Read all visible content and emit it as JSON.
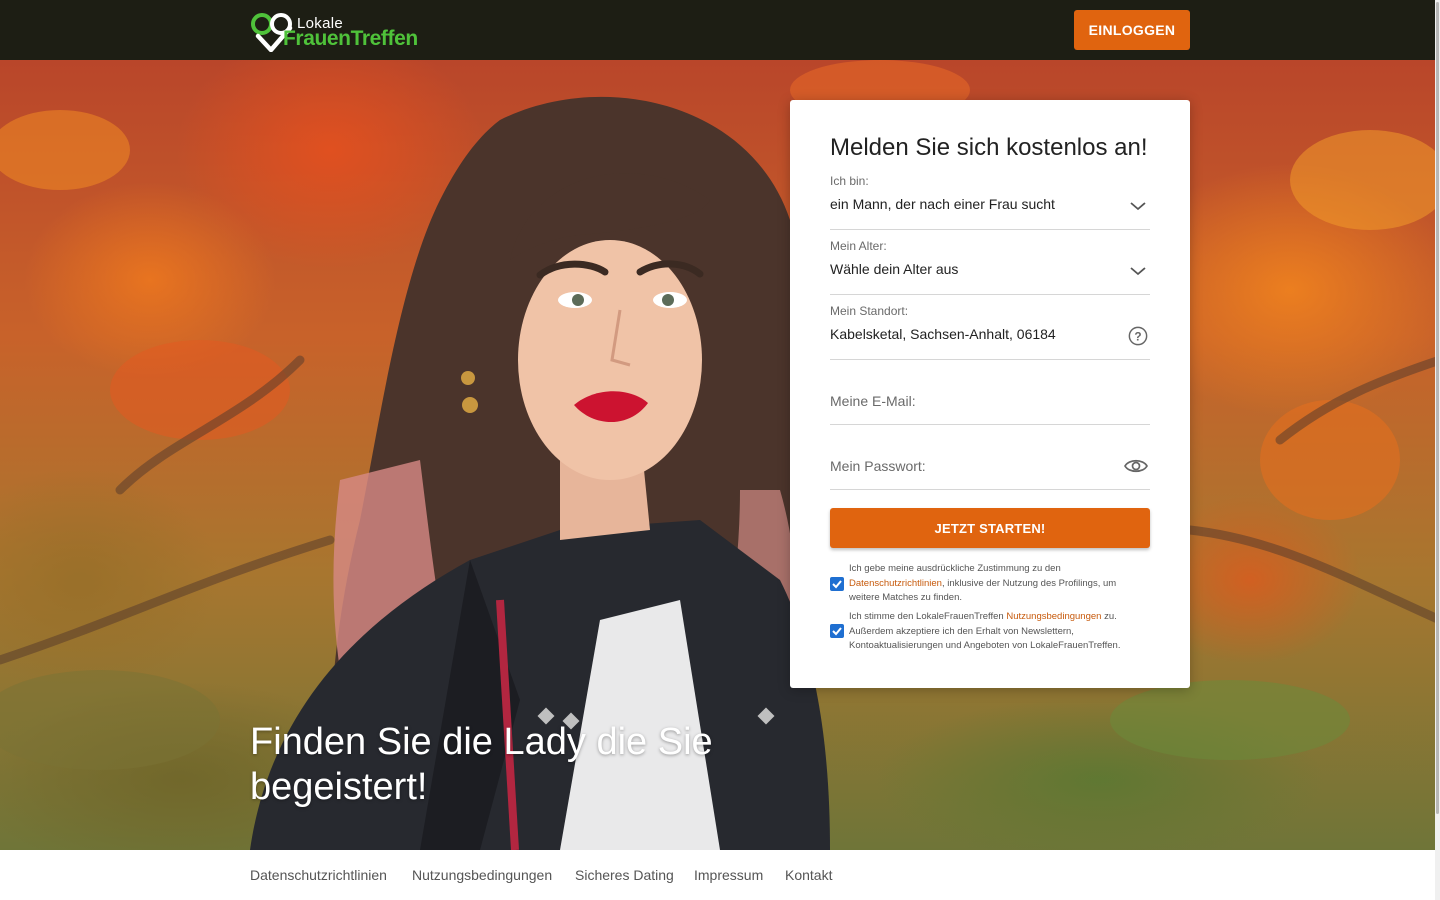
{
  "header": {
    "logo_line1": "Lokale",
    "logo_line2": "FrauenTreffen",
    "login_label": "EINLOGGEN"
  },
  "hero": {
    "headline": "Finden Sie die Lady die Sie begeistert!"
  },
  "signup": {
    "title": "Melden Sie sich kostenlos an!",
    "gender_label": "Ich bin:",
    "gender_value": "ein Mann, der nach einer Frau sucht",
    "age_label": "Mein Alter:",
    "age_value": "Wähle dein Alter aus",
    "location_label": "Mein Standort:",
    "location_value": "Kabelsketal, Sachsen-Anhalt, 06184",
    "email_placeholder": "Meine E-Mail:",
    "password_placeholder": "Mein Passwort:",
    "submit_label": "JETZT STARTEN!",
    "consent1": {
      "checked": true,
      "before": "Ich gebe meine ausdrückliche Zustimmung zu den ",
      "link": "Datenschutzrichtlinien",
      "after": ", inklusive der Nutzung des Profilings, um weitere Matches zu finden."
    },
    "consent2": {
      "checked": true,
      "before": "Ich stimme den LokaleFrauenTreffen ",
      "link": "Nutzungsbedingungen",
      "after": " zu. Außerdem akzeptiere ich den Erhalt von Newslettern, Kontoaktualisierungen und Angeboten von LokaleFrauenTreffen."
    }
  },
  "footer": {
    "links": [
      "Datenschutzrichtlinien",
      "Nutzungsbedingungen",
      "Sicheres Dating",
      "Impressum",
      "Kontakt"
    ]
  },
  "colors": {
    "accent": "#e0640f",
    "header_bg": "#1d1e14",
    "logo_green": "#4fc23a",
    "checkbox": "#1f6fd1"
  },
  "icons": {
    "logo": "heart-pin-icon",
    "select": "chevron-down-icon",
    "location_help": "question-circle-icon",
    "password_toggle": "eye-icon",
    "checkbox": "checkmark-icon"
  }
}
